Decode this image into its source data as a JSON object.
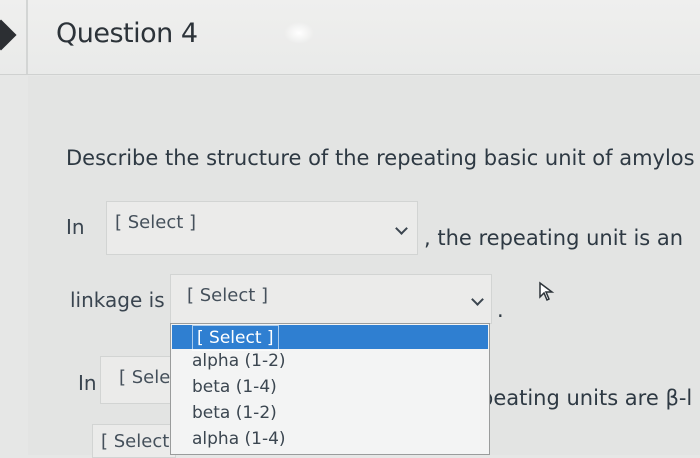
{
  "header": {
    "title": "Question 4"
  },
  "question": {
    "prompt": "Describe the structure of the repeating basic unit of amylos",
    "row1": {
      "label": "In",
      "select_value": "[ Select ]",
      "after": ", the repeating unit is an"
    },
    "row2": {
      "label": "linkage is",
      "select_value": "[ Select ]",
      "after": "."
    },
    "row3": {
      "label": "In",
      "select_value": "[ Selec",
      "after": "peating units are β-l"
    },
    "row4": {
      "select_value": "[ Select ]"
    }
  },
  "dropdown": {
    "options": [
      "[ Select ]",
      "alpha (1-2)",
      "beta (1-4)",
      "beta (1-2)",
      "alpha (1-4)"
    ],
    "selected_index": 0
  },
  "colors": {
    "highlight": "#2f7fd1",
    "background": "#e6e7e6"
  }
}
